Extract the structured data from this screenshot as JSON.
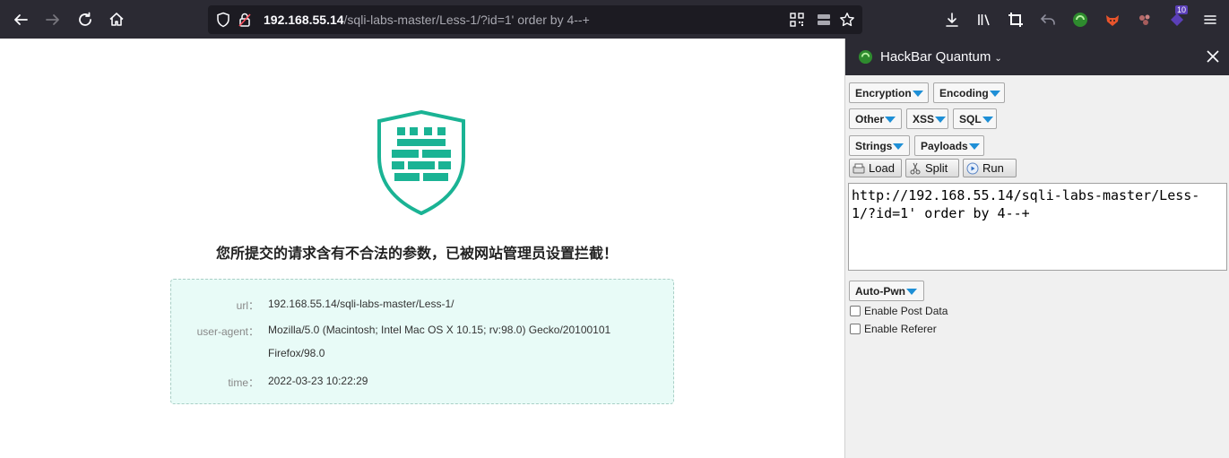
{
  "browser": {
    "url_host": "192.168.55.14",
    "url_path": "/sqli-labs-master/Less-1/?id=1' order by 4--+",
    "badge_count": "10"
  },
  "waf_page": {
    "message": "您所提交的请求含有不合法的参数，已被网站管理员设置拦截！",
    "info": [
      {
        "key": "url：",
        "value": "192.168.55.14/sqli-labs-master/Less-1/"
      },
      {
        "key": "user-agent：",
        "value": "Mozilla/5.0 (Macintosh; Intel Mac OS X 10.15; rv:98.0) Gecko/20100101 Firefox/98.0"
      },
      {
        "key": "time：",
        "value": "2022-03-23 10:22:29"
      }
    ]
  },
  "hackbar": {
    "title": "HackBar Quantum",
    "menus": [
      "Encryption",
      "Encoding",
      "Other",
      "XSS",
      "SQL",
      "Strings",
      "Payloads"
    ],
    "actions": [
      "Load",
      "Split",
      "Run"
    ],
    "url_value": "http://192.168.55.14/sqli-labs-master/Less-1/?id=1' order by 4--+",
    "auto_pwn": "Auto-Pwn",
    "checkboxes": [
      "Enable Post Data",
      "Enable Referer"
    ]
  },
  "colors": {
    "shield": "#1ab394",
    "toolbar": "#2b2a33",
    "info_bg": "#e8fbf7",
    "dropdown_arrow": "#1e8fd6"
  }
}
